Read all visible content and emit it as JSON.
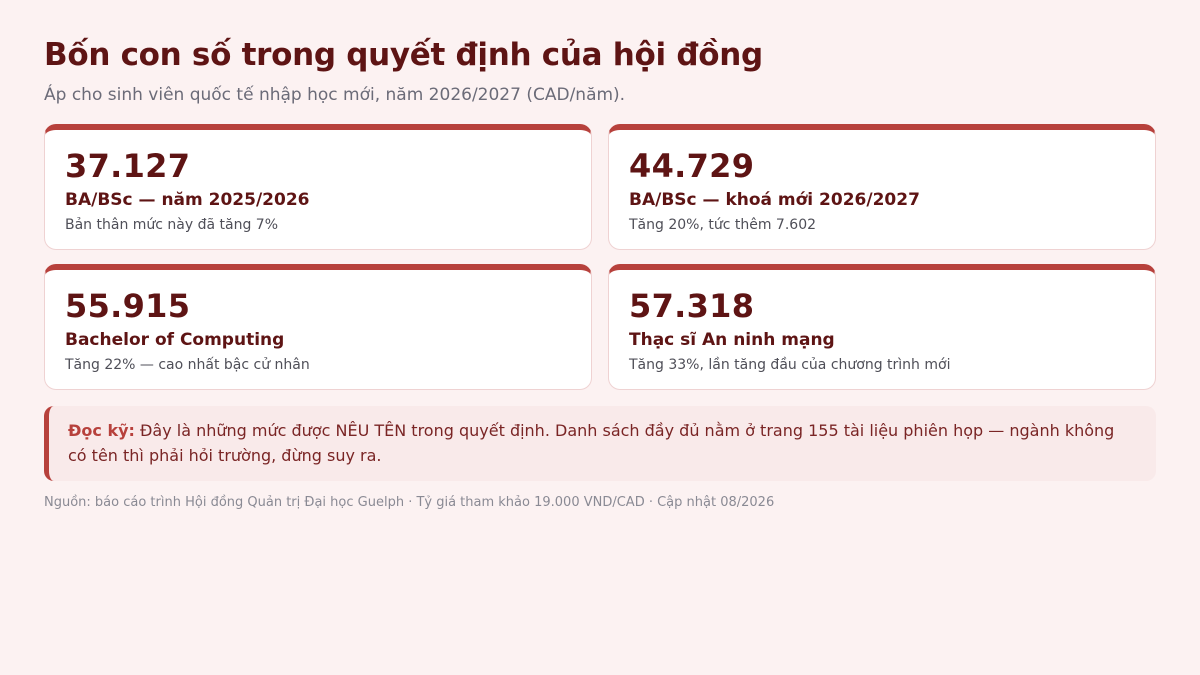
{
  "header": {
    "title": "Bốn con số trong quyết định của hội đồng",
    "subtitle": "Áp cho sinh viên quốc tế nhập học mới, năm 2026/2027 (CAD/năm)."
  },
  "cards": [
    {
      "value": "37.127",
      "label": "BA/BSc — năm 2025/2026",
      "note": "Bản thân mức này đã tăng 7%"
    },
    {
      "value": "44.729",
      "label": "BA/BSc — khoá mới 2026/2027",
      "note": "Tăng 20%, tức thêm 7.602"
    },
    {
      "value": "55.915",
      "label": "Bachelor of Computing",
      "note": "Tăng 22% — cao nhất bậc cử nhân"
    },
    {
      "value": "57.318",
      "label": "Thạc sĩ An ninh mạng",
      "note": "Tăng 33%, lần tăng đầu của chương trình mới"
    }
  ],
  "notice": {
    "strong": "Đọc kỹ:",
    "text": " Đây là những mức được NÊU TÊN trong quyết định. Danh sách đầy đủ nằm ở trang 155 tài liệu phiên họp — ngành không có tên thì phải hỏi trường, đừng suy ra."
  },
  "footer": {
    "source": "Nguồn: báo cáo trình Hội đồng Quản trị Đại học Guelph · Tỷ giá tham khảo 19.000 VND/CAD · Cập nhật 08/2026"
  },
  "colors": {
    "background": "#fcf2f2",
    "accent": "#b7413c",
    "heading": "#5e1414",
    "card_background": "#ffffff"
  }
}
